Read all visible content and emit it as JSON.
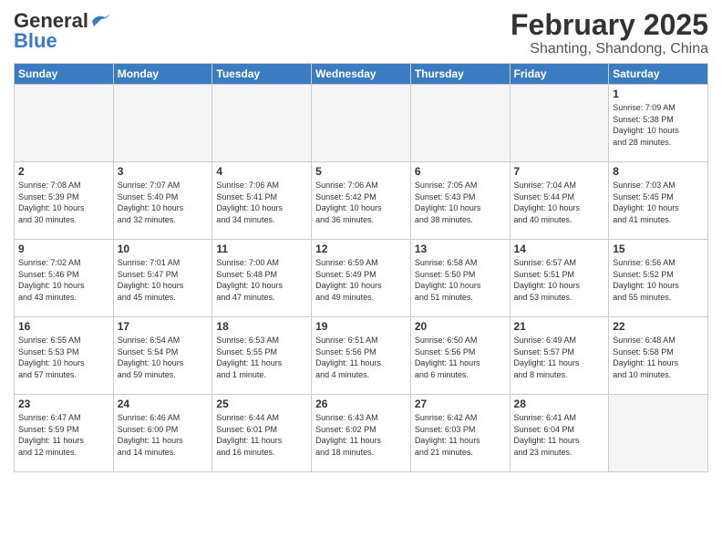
{
  "header": {
    "logo_general": "General",
    "logo_blue": "Blue",
    "month_year": "February 2025",
    "location": "Shanting, Shandong, China"
  },
  "days_of_week": [
    "Sunday",
    "Monday",
    "Tuesday",
    "Wednesday",
    "Thursday",
    "Friday",
    "Saturday"
  ],
  "weeks": [
    [
      {
        "day": "",
        "info": "",
        "empty": true
      },
      {
        "day": "",
        "info": "",
        "empty": true
      },
      {
        "day": "",
        "info": "",
        "empty": true
      },
      {
        "day": "",
        "info": "",
        "empty": true
      },
      {
        "day": "",
        "info": "",
        "empty": true
      },
      {
        "day": "",
        "info": "",
        "empty": true
      },
      {
        "day": "1",
        "info": "Sunrise: 7:09 AM\nSunset: 5:38 PM\nDaylight: 10 hours\nand 28 minutes."
      }
    ],
    [
      {
        "day": "2",
        "info": "Sunrise: 7:08 AM\nSunset: 5:39 PM\nDaylight: 10 hours\nand 30 minutes."
      },
      {
        "day": "3",
        "info": "Sunrise: 7:07 AM\nSunset: 5:40 PM\nDaylight: 10 hours\nand 32 minutes."
      },
      {
        "day": "4",
        "info": "Sunrise: 7:06 AM\nSunset: 5:41 PM\nDaylight: 10 hours\nand 34 minutes."
      },
      {
        "day": "5",
        "info": "Sunrise: 7:06 AM\nSunset: 5:42 PM\nDaylight: 10 hours\nand 36 minutes."
      },
      {
        "day": "6",
        "info": "Sunrise: 7:05 AM\nSunset: 5:43 PM\nDaylight: 10 hours\nand 38 minutes."
      },
      {
        "day": "7",
        "info": "Sunrise: 7:04 AM\nSunset: 5:44 PM\nDaylight: 10 hours\nand 40 minutes."
      },
      {
        "day": "8",
        "info": "Sunrise: 7:03 AM\nSunset: 5:45 PM\nDaylight: 10 hours\nand 41 minutes."
      }
    ],
    [
      {
        "day": "9",
        "info": "Sunrise: 7:02 AM\nSunset: 5:46 PM\nDaylight: 10 hours\nand 43 minutes."
      },
      {
        "day": "10",
        "info": "Sunrise: 7:01 AM\nSunset: 5:47 PM\nDaylight: 10 hours\nand 45 minutes."
      },
      {
        "day": "11",
        "info": "Sunrise: 7:00 AM\nSunset: 5:48 PM\nDaylight: 10 hours\nand 47 minutes."
      },
      {
        "day": "12",
        "info": "Sunrise: 6:59 AM\nSunset: 5:49 PM\nDaylight: 10 hours\nand 49 minutes."
      },
      {
        "day": "13",
        "info": "Sunrise: 6:58 AM\nSunset: 5:50 PM\nDaylight: 10 hours\nand 51 minutes."
      },
      {
        "day": "14",
        "info": "Sunrise: 6:57 AM\nSunset: 5:51 PM\nDaylight: 10 hours\nand 53 minutes."
      },
      {
        "day": "15",
        "info": "Sunrise: 6:56 AM\nSunset: 5:52 PM\nDaylight: 10 hours\nand 55 minutes."
      }
    ],
    [
      {
        "day": "16",
        "info": "Sunrise: 6:55 AM\nSunset: 5:53 PM\nDaylight: 10 hours\nand 57 minutes."
      },
      {
        "day": "17",
        "info": "Sunrise: 6:54 AM\nSunset: 5:54 PM\nDaylight: 10 hours\nand 59 minutes."
      },
      {
        "day": "18",
        "info": "Sunrise: 6:53 AM\nSunset: 5:55 PM\nDaylight: 11 hours\nand 1 minute."
      },
      {
        "day": "19",
        "info": "Sunrise: 6:51 AM\nSunset: 5:56 PM\nDaylight: 11 hours\nand 4 minutes."
      },
      {
        "day": "20",
        "info": "Sunrise: 6:50 AM\nSunset: 5:56 PM\nDaylight: 11 hours\nand 6 minutes."
      },
      {
        "day": "21",
        "info": "Sunrise: 6:49 AM\nSunset: 5:57 PM\nDaylight: 11 hours\nand 8 minutes."
      },
      {
        "day": "22",
        "info": "Sunrise: 6:48 AM\nSunset: 5:58 PM\nDaylight: 11 hours\nand 10 minutes."
      }
    ],
    [
      {
        "day": "23",
        "info": "Sunrise: 6:47 AM\nSunset: 5:59 PM\nDaylight: 11 hours\nand 12 minutes."
      },
      {
        "day": "24",
        "info": "Sunrise: 6:46 AM\nSunset: 6:00 PM\nDaylight: 11 hours\nand 14 minutes."
      },
      {
        "day": "25",
        "info": "Sunrise: 6:44 AM\nSunset: 6:01 PM\nDaylight: 11 hours\nand 16 minutes."
      },
      {
        "day": "26",
        "info": "Sunrise: 6:43 AM\nSunset: 6:02 PM\nDaylight: 11 hours\nand 18 minutes."
      },
      {
        "day": "27",
        "info": "Sunrise: 6:42 AM\nSunset: 6:03 PM\nDaylight: 11 hours\nand 21 minutes."
      },
      {
        "day": "28",
        "info": "Sunrise: 6:41 AM\nSunset: 6:04 PM\nDaylight: 11 hours\nand 23 minutes."
      },
      {
        "day": "",
        "info": "",
        "empty": true
      }
    ]
  ]
}
